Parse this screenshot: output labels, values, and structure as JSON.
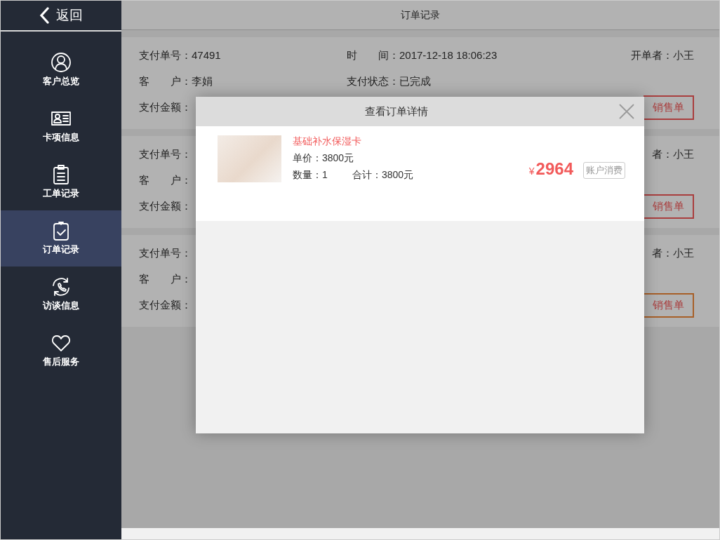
{
  "sidebar": {
    "back_label": "返回",
    "items": [
      {
        "kind": "person",
        "label": "客户总览",
        "selected": false
      },
      {
        "kind": "card",
        "label": "卡项信息",
        "selected": false
      },
      {
        "kind": "clipboard",
        "label": "工单记录",
        "selected": false
      },
      {
        "kind": "check",
        "label": "订单记录",
        "selected": true
      },
      {
        "kind": "phone",
        "label": "访谈信息",
        "selected": false
      },
      {
        "kind": "heart",
        "label": "售后服务",
        "selected": false
      }
    ]
  },
  "page_title": "订单记录",
  "orders": [
    {
      "rows": [
        {
          "left": "支付单号：47491",
          "middle": "时　　间：2017-12-18 18:06:23",
          "right": "开单者：小王"
        },
        {
          "left": "客　　户：李娟",
          "middle": "支付状态：已完成"
        },
        {
          "left": "支付金额："
        }
      ],
      "button": {
        "label": "销售单",
        "focused": false
      }
    },
    {
      "rows": [
        {
          "left": "支付单号：",
          "right": "者：小王"
        },
        {
          "left": "客　　户："
        },
        {
          "left": "支付金额："
        }
      ],
      "button": {
        "label": "销售单",
        "focused": false
      }
    },
    {
      "rows": [
        {
          "left": "支付单号：",
          "right": "者：小王"
        },
        {
          "left": "客　　户："
        },
        {
          "left": "支付金额："
        }
      ],
      "button": {
        "label": "销售单",
        "focused": true
      }
    }
  ],
  "modal": {
    "title": "查看订单详情",
    "items": [
      {
        "name": "基础补水保湿卡",
        "unit_price": "单价：3800元",
        "quantity": "数量：1",
        "total": "合计：3800元",
        "currency": "¥",
        "amount": "2964",
        "tag": "账户消费"
      }
    ]
  }
}
